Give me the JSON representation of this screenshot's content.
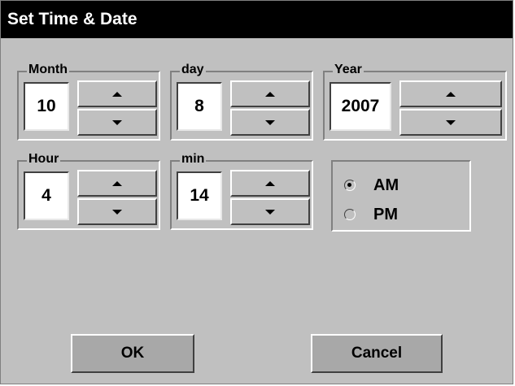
{
  "window": {
    "title": "Set Time & Date"
  },
  "fields": {
    "month": {
      "label": "Month",
      "value": "10"
    },
    "day": {
      "label": "day",
      "value": "8"
    },
    "year": {
      "label": "Year",
      "value": "2007"
    },
    "hour": {
      "label": "Hour",
      "value": "4"
    },
    "min": {
      "label": "min",
      "value": "14"
    }
  },
  "ampm": {
    "selected": "AM",
    "options": [
      {
        "label": "AM"
      },
      {
        "label": "PM"
      }
    ]
  },
  "buttons": {
    "ok": "OK",
    "cancel": "Cancel"
  },
  "icons": {
    "increment": "arrow-up-icon",
    "decrement": "arrow-down-icon"
  }
}
